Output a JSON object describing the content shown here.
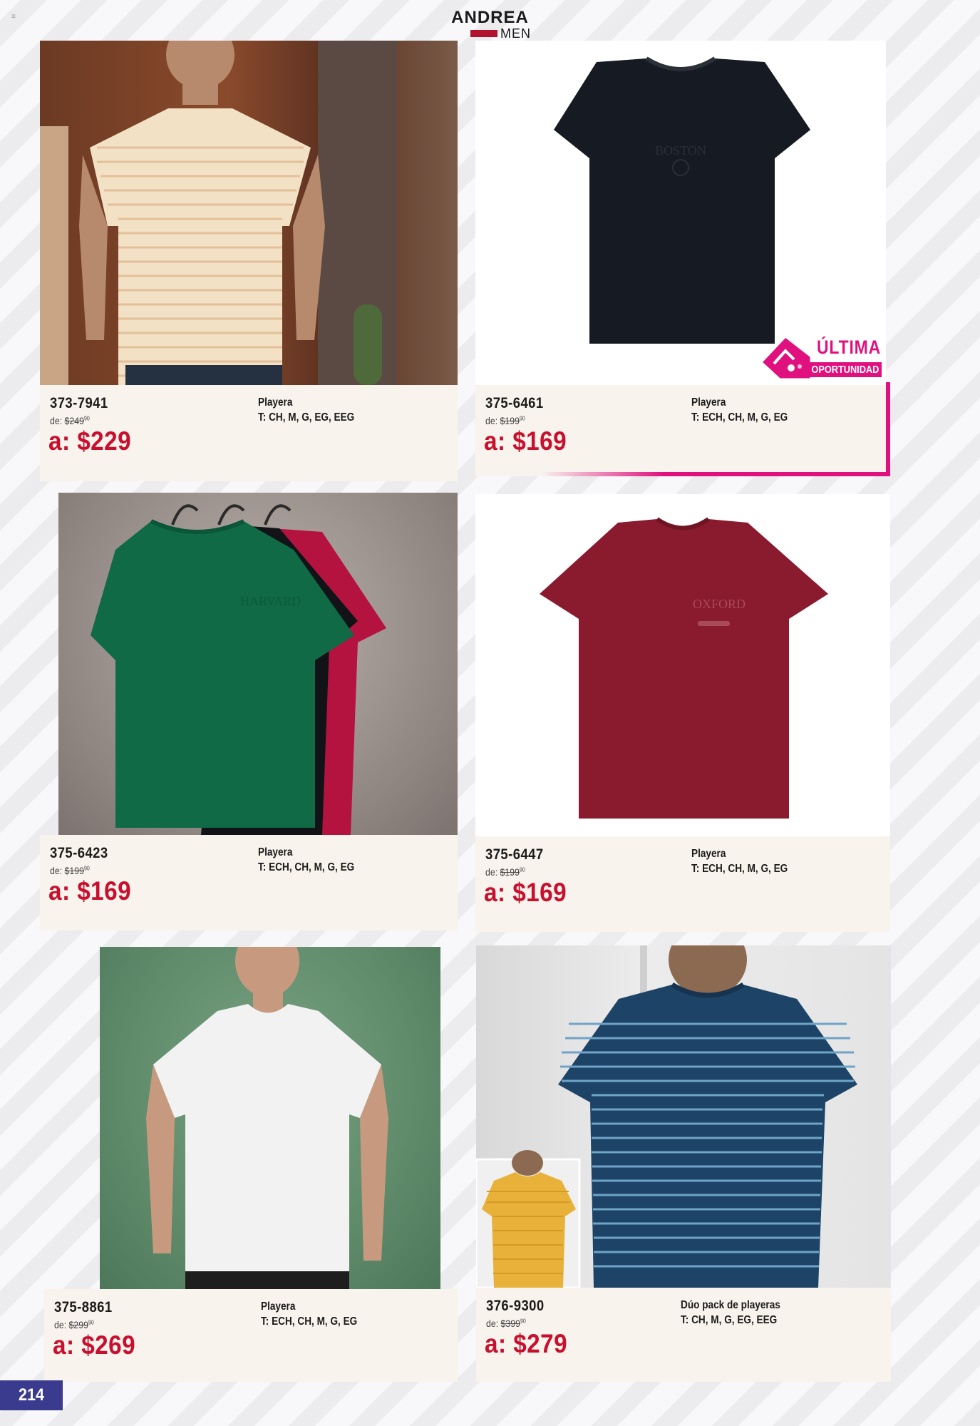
{
  "brand": {
    "name": "ANDREA",
    "sub": "MEN"
  },
  "top_mark": "≡",
  "page_number": "214",
  "badge": {
    "line1": "ÚLTIMA",
    "line2": "OPORTUNIDAD"
  },
  "colors": {
    "price_red": "#c8102e",
    "badge_pink": "#e0117f",
    "page_badge": "#3a3a8e"
  },
  "products": [
    {
      "code": "373-7941",
      "old_label": "de:",
      "old_price": "$249",
      "old_dec": "90",
      "new_price": "a: $229",
      "name": "Playera",
      "sizes": "T: CH, M, G, EG, EEG"
    },
    {
      "code": "375-6461",
      "old_label": "de:",
      "old_price": "$199",
      "old_dec": "90",
      "new_price": "a: $169",
      "name": "Playera",
      "sizes": "T: ECH, CH, M, G, EG"
    },
    {
      "code": "375-6423",
      "old_label": "de:",
      "old_price": "$199",
      "old_dec": "90",
      "new_price": "a: $169",
      "name": "Playera",
      "sizes": "T: ECH, CH, M, G, EG"
    },
    {
      "code": "375-6447",
      "old_label": "de:",
      "old_price": "$199",
      "old_dec": "90",
      "new_price": "a: $169",
      "name": "Playera",
      "sizes": "T: ECH, CH, M, G, EG"
    },
    {
      "code": "375-8861",
      "old_label": "de:",
      "old_price": "$299",
      "old_dec": "90",
      "new_price": "a: $269",
      "name": "Playera",
      "sizes": "T: ECH, CH, M, G, EG"
    },
    {
      "code": "376-9300",
      "old_label": "de:",
      "old_price": "$399",
      "old_dec": "90",
      "new_price": "a: $279",
      "name": "Dúo pack de playeras",
      "sizes": "T: CH, M, G, EG, EEG"
    }
  ]
}
